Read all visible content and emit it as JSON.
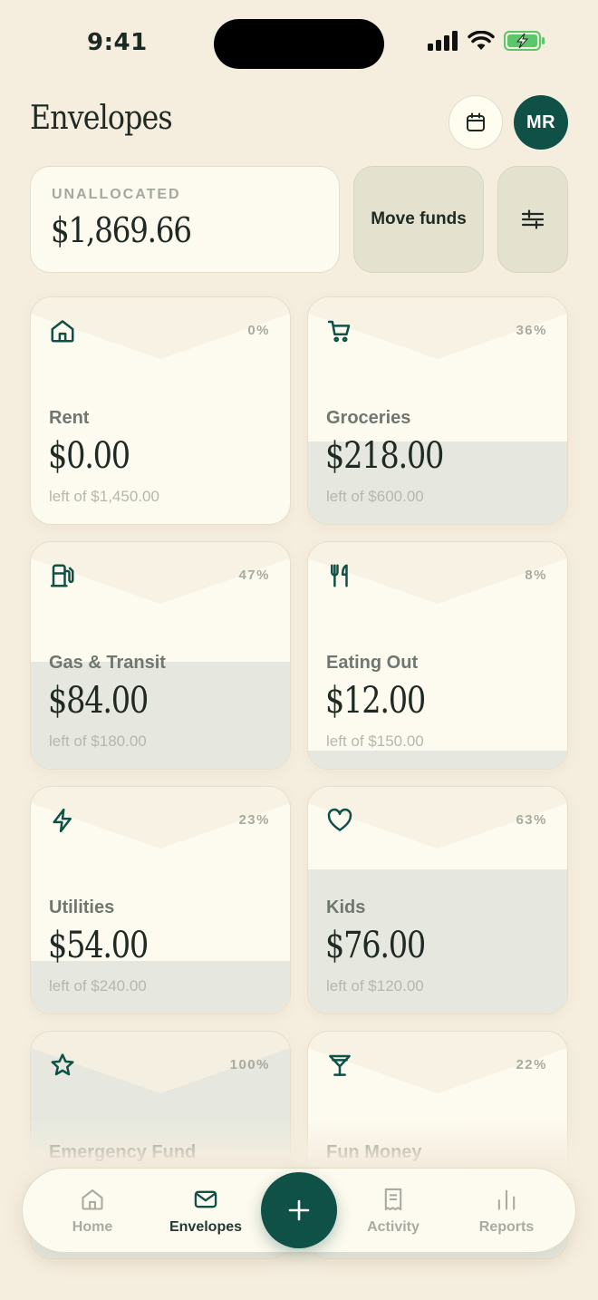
{
  "status_bar": {
    "time": "9:41"
  },
  "header": {
    "title": "Envelopes",
    "avatar_initials": "MR"
  },
  "summary": {
    "unallocated_label": "UNALLOCATED",
    "unallocated_amount": "$1,869.66",
    "move_funds_label": "Move funds"
  },
  "envelopes": [
    {
      "name": "Rent",
      "amount": "$0.00",
      "sub": "left of $1,450.00",
      "pct": "0%",
      "icon": "home-icon",
      "remaining_fraction": 0
    },
    {
      "name": "Groceries",
      "amount": "$218.00",
      "sub": "left of $600.00",
      "pct": "36%",
      "icon": "cart-icon",
      "remaining_fraction": 0.36
    },
    {
      "name": "Gas & Transit",
      "amount": "$84.00",
      "sub": "left of $180.00",
      "pct": "47%",
      "icon": "fuel-icon",
      "remaining_fraction": 0.47
    },
    {
      "name": "Eating Out",
      "amount": "$12.00",
      "sub": "left of $150.00",
      "pct": "8%",
      "icon": "utensils-icon",
      "remaining_fraction": 0.08
    },
    {
      "name": "Utilities",
      "amount": "$54.00",
      "sub": "left of $240.00",
      "pct": "23%",
      "icon": "bolt-icon",
      "remaining_fraction": 0.23
    },
    {
      "name": "Kids",
      "amount": "$76.00",
      "sub": "left of $120.00",
      "pct": "63%",
      "icon": "heart-icon",
      "remaining_fraction": 0.63
    },
    {
      "name": "Emergency Fund",
      "amount": "",
      "sub": "",
      "pct": "100%",
      "icon": "star-icon",
      "remaining_fraction": 1
    },
    {
      "name": "Fun Money",
      "amount": "",
      "sub": "",
      "pct": "22%",
      "icon": "cocktail-icon",
      "remaining_fraction": 0.22
    }
  ],
  "nav": {
    "home": "Home",
    "envelopes": "Envelopes",
    "activity": "Activity",
    "reports": "Reports"
  },
  "colors": {
    "background": "#f5edde",
    "accent": "#0f5047",
    "card": "#fdfaef",
    "fill": "#e6e8df"
  }
}
